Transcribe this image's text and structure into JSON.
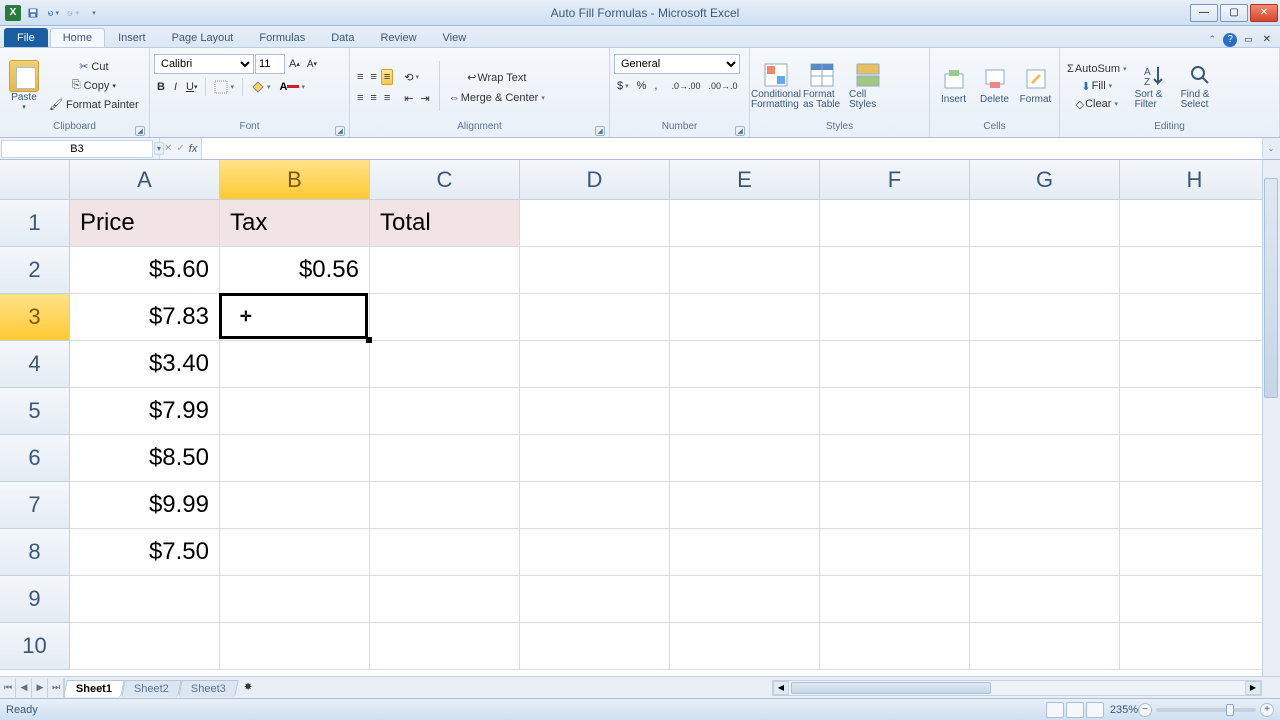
{
  "app": {
    "title": "Auto Fill Formulas - Microsoft Excel",
    "status": "Ready",
    "zoom": "235%"
  },
  "tabs": {
    "file": "File",
    "list": [
      "Home",
      "Insert",
      "Page Layout",
      "Formulas",
      "Data",
      "Review",
      "View"
    ],
    "active": "Home"
  },
  "ribbon": {
    "clipboard": {
      "label": "Clipboard",
      "paste": "Paste",
      "cut": "Cut",
      "copy": "Copy",
      "painter": "Format Painter"
    },
    "font": {
      "label": "Font",
      "name": "Calibri",
      "size": "11"
    },
    "alignment": {
      "label": "Alignment",
      "wrap": "Wrap Text",
      "merge": "Merge & Center"
    },
    "number": {
      "label": "Number",
      "format": "General"
    },
    "styles": {
      "label": "Styles",
      "cond": "Conditional Formatting",
      "table": "Format as Table",
      "cell": "Cell Styles"
    },
    "cells": {
      "label": "Cells",
      "insert": "Insert",
      "delete": "Delete",
      "format": "Format"
    },
    "editing": {
      "label": "Editing",
      "sum": "AutoSum",
      "fill": "Fill",
      "clear": "Clear",
      "sort": "Sort & Filter",
      "find": "Find & Select"
    }
  },
  "namebox": "B3",
  "formula": "",
  "columns": [
    "A",
    "B",
    "C",
    "D",
    "E",
    "F",
    "G",
    "H"
  ],
  "rows": [
    "1",
    "2",
    "3",
    "4",
    "5",
    "6",
    "7",
    "8",
    "9",
    "10"
  ],
  "active_col": "B",
  "active_row": "3",
  "cells": {
    "A1": "Price",
    "B1": "Tax",
    "C1": "Total",
    "A2": "$5.60",
    "B2": "$0.56",
    "A3": "$7.83",
    "A4": "$3.40",
    "A5": "$7.99",
    "A6": "$8.50",
    "A7": "$9.99",
    "A8": "$7.50"
  },
  "sheets": {
    "list": [
      "Sheet1",
      "Sheet2",
      "Sheet3"
    ],
    "active": "Sheet1"
  }
}
